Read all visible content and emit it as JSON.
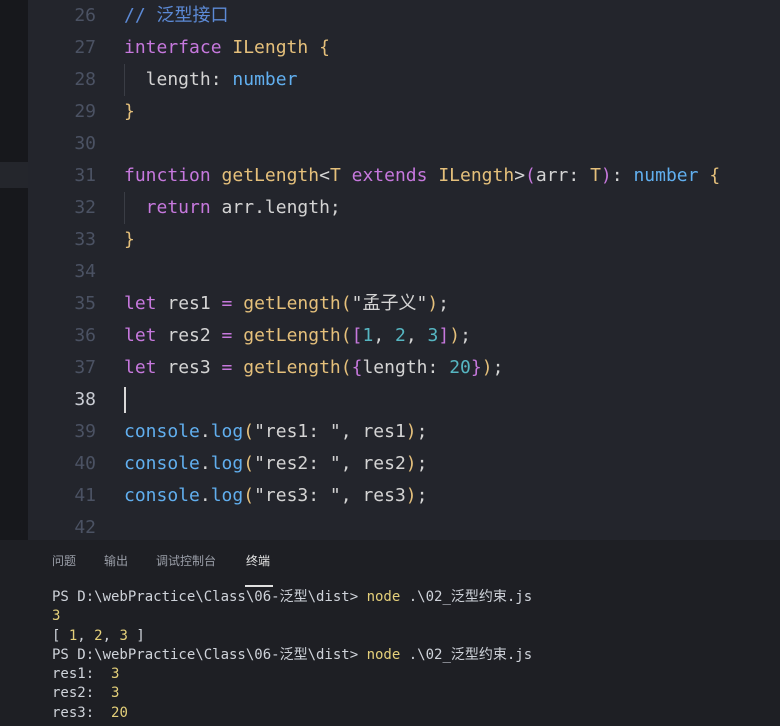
{
  "editor": {
    "active_line": "38",
    "lines": [
      {
        "num": "26",
        "segments": [
          {
            "t": "// 泛型接口",
            "c": "cm"
          }
        ]
      },
      {
        "num": "27",
        "segments": [
          {
            "t": "interface ",
            "c": "kw"
          },
          {
            "t": "ILength ",
            "c": "tp"
          },
          {
            "t": "{",
            "c": "br1"
          }
        ]
      },
      {
        "num": "28",
        "segments": [
          {
            "t": "  length",
            "c": "pn"
          },
          {
            "t": ": ",
            "c": "pn"
          },
          {
            "t": "number",
            "c": "tp2"
          }
        ]
      },
      {
        "num": "29",
        "segments": [
          {
            "t": "}",
            "c": "br1"
          }
        ]
      },
      {
        "num": "30",
        "segments": []
      },
      {
        "num": "31",
        "segments": [
          {
            "t": "function ",
            "c": "kw"
          },
          {
            "t": "getLength",
            "c": "fn"
          },
          {
            "t": "<",
            "c": "pn"
          },
          {
            "t": "T ",
            "c": "tp"
          },
          {
            "t": "extends ",
            "c": "kw"
          },
          {
            "t": "ILength",
            "c": "tp"
          },
          {
            "t": ">",
            "c": "pn"
          },
          {
            "t": "(",
            "c": "br2"
          },
          {
            "t": "arr",
            "c": "pn"
          },
          {
            "t": ": ",
            "c": "pn"
          },
          {
            "t": "T",
            "c": "tp"
          },
          {
            "t": ")",
            "c": "br2"
          },
          {
            "t": ": ",
            "c": "pn"
          },
          {
            "t": "number ",
            "c": "tp2"
          },
          {
            "t": "{",
            "c": "br1"
          }
        ]
      },
      {
        "num": "32",
        "segments": [
          {
            "t": "  return ",
            "c": "kw"
          },
          {
            "t": "arr",
            "c": "pn"
          },
          {
            "t": ".length;",
            "c": "pn"
          }
        ]
      },
      {
        "num": "33",
        "segments": [
          {
            "t": "}",
            "c": "br1"
          }
        ]
      },
      {
        "num": "34",
        "segments": []
      },
      {
        "num": "35",
        "segments": [
          {
            "t": "let ",
            "c": "kw"
          },
          {
            "t": "res1 ",
            "c": "pn"
          },
          {
            "t": "= ",
            "c": "kw"
          },
          {
            "t": "getLength",
            "c": "fn"
          },
          {
            "t": "(",
            "c": "br1"
          },
          {
            "t": "\"孟子义\"",
            "c": "pn"
          },
          {
            "t": ")",
            "c": "br1"
          },
          {
            "t": ";",
            "c": "pn"
          }
        ]
      },
      {
        "num": "36",
        "segments": [
          {
            "t": "let ",
            "c": "kw"
          },
          {
            "t": "res2 ",
            "c": "pn"
          },
          {
            "t": "= ",
            "c": "kw"
          },
          {
            "t": "getLength",
            "c": "fn"
          },
          {
            "t": "(",
            "c": "br1"
          },
          {
            "t": "[",
            "c": "br2"
          },
          {
            "t": "1",
            "c": "nm"
          },
          {
            "t": ", ",
            "c": "pn"
          },
          {
            "t": "2",
            "c": "nm"
          },
          {
            "t": ", ",
            "c": "pn"
          },
          {
            "t": "3",
            "c": "nm"
          },
          {
            "t": "]",
            "c": "br2"
          },
          {
            "t": ")",
            "c": "br1"
          },
          {
            "t": ";",
            "c": "pn"
          }
        ]
      },
      {
        "num": "37",
        "segments": [
          {
            "t": "let ",
            "c": "kw"
          },
          {
            "t": "res3 ",
            "c": "pn"
          },
          {
            "t": "= ",
            "c": "kw"
          },
          {
            "t": "getLength",
            "c": "fn"
          },
          {
            "t": "(",
            "c": "br1"
          },
          {
            "t": "{",
            "c": "br2"
          },
          {
            "t": "length",
            "c": "pn"
          },
          {
            "t": ": ",
            "c": "pn"
          },
          {
            "t": "20",
            "c": "nm"
          },
          {
            "t": "}",
            "c": "br2"
          },
          {
            "t": ")",
            "c": "br1"
          },
          {
            "t": ";",
            "c": "pn"
          }
        ]
      },
      {
        "num": "38",
        "segments": []
      },
      {
        "num": "39",
        "segments": [
          {
            "t": "console",
            "c": "tp2"
          },
          {
            "t": ".",
            "c": "pn"
          },
          {
            "t": "log",
            "c": "tp2"
          },
          {
            "t": "(",
            "c": "br1"
          },
          {
            "t": "\"res1: \"",
            "c": "pn"
          },
          {
            "t": ", res1",
            "c": "pn"
          },
          {
            "t": ")",
            "c": "br1"
          },
          {
            "t": ";",
            "c": "pn"
          }
        ]
      },
      {
        "num": "40",
        "segments": [
          {
            "t": "console",
            "c": "tp2"
          },
          {
            "t": ".",
            "c": "pn"
          },
          {
            "t": "log",
            "c": "tp2"
          },
          {
            "t": "(",
            "c": "br1"
          },
          {
            "t": "\"res2: \"",
            "c": "pn"
          },
          {
            "t": ", res2",
            "c": "pn"
          },
          {
            "t": ")",
            "c": "br1"
          },
          {
            "t": ";",
            "c": "pn"
          }
        ]
      },
      {
        "num": "41",
        "segments": [
          {
            "t": "console",
            "c": "tp2"
          },
          {
            "t": ".",
            "c": "pn"
          },
          {
            "t": "log",
            "c": "tp2"
          },
          {
            "t": "(",
            "c": "br1"
          },
          {
            "t": "\"res3: \"",
            "c": "pn"
          },
          {
            "t": ", res3",
            "c": "pn"
          },
          {
            "t": ")",
            "c": "br1"
          },
          {
            "t": ";",
            "c": "pn"
          }
        ]
      },
      {
        "num": "42",
        "segments": []
      }
    ]
  },
  "panel": {
    "tabs": {
      "problems": "问题",
      "output": "输出",
      "debug_console": "调试控制台",
      "terminal": "终端"
    },
    "active_tab": "terminal",
    "terminal_lines": [
      {
        "segments": [
          {
            "t": "PS D:\\webPractice\\Class\\06-泛型\\dist> ",
            "c": ""
          },
          {
            "t": "node",
            "c": "t-yellow"
          },
          {
            "t": " .\\02_泛型约束.js",
            "c": ""
          }
        ]
      },
      {
        "segments": [
          {
            "t": "3",
            "c": "t-yellow"
          }
        ]
      },
      {
        "segments": [
          {
            "t": "[ ",
            "c": ""
          },
          {
            "t": "1",
            "c": "t-yellow"
          },
          {
            "t": ", ",
            "c": ""
          },
          {
            "t": "2",
            "c": "t-yellow"
          },
          {
            "t": ", ",
            "c": ""
          },
          {
            "t": "3",
            "c": "t-yellow"
          },
          {
            "t": " ]",
            "c": ""
          }
        ]
      },
      {
        "segments": [
          {
            "t": "PS D:\\webPractice\\Class\\06-泛型\\dist> ",
            "c": ""
          },
          {
            "t": "node",
            "c": "t-yellow"
          },
          {
            "t": " .\\02_泛型约束.js",
            "c": ""
          }
        ]
      },
      {
        "segments": [
          {
            "t": "res1:  ",
            "c": ""
          },
          {
            "t": "3",
            "c": "t-yellow"
          }
        ]
      },
      {
        "segments": [
          {
            "t": "res2:  ",
            "c": ""
          },
          {
            "t": "3",
            "c": "t-yellow"
          }
        ]
      },
      {
        "segments": [
          {
            "t": "res3:  ",
            "c": ""
          },
          {
            "t": "20",
            "c": "t-yellow"
          }
        ]
      }
    ]
  }
}
